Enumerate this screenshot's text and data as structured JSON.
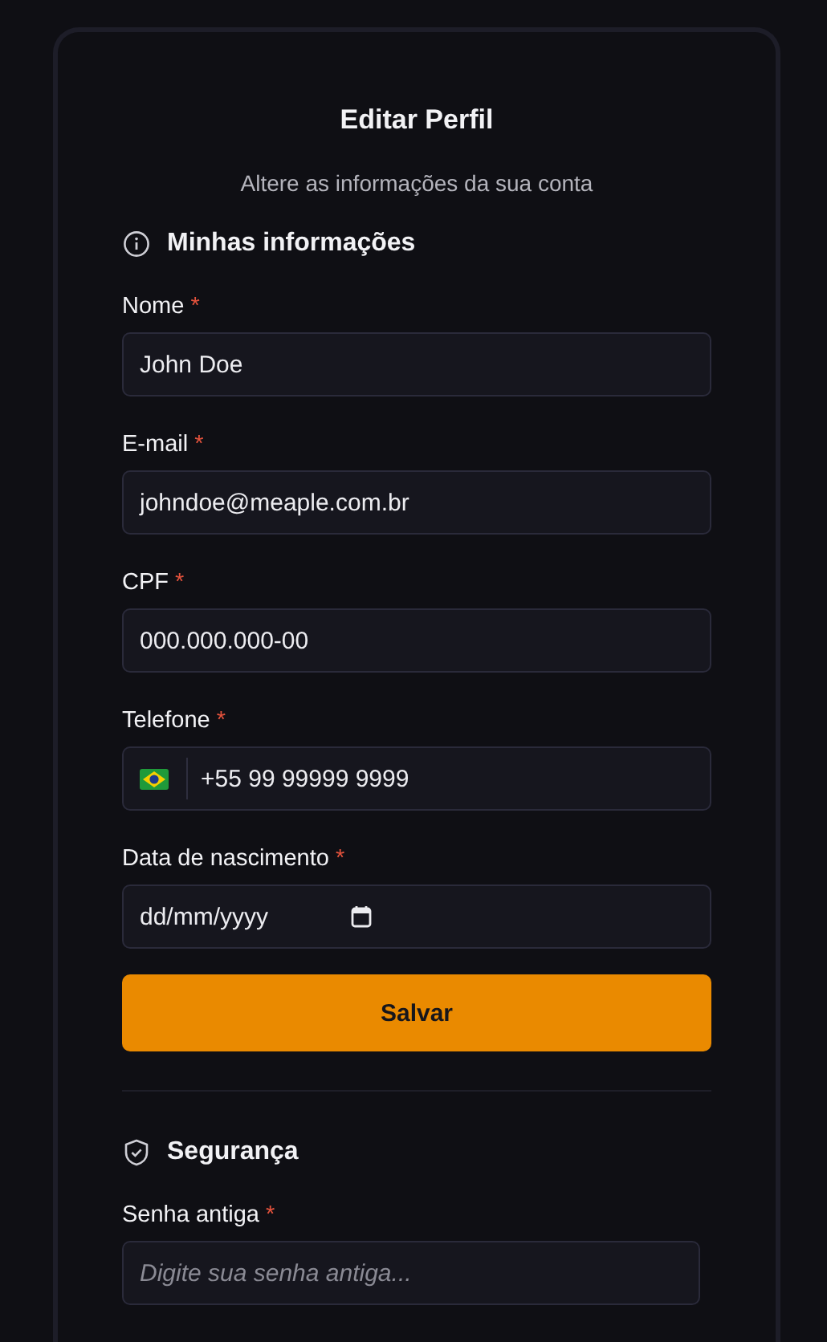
{
  "title": "Editar Perfil",
  "subtitle": "Altere as informações da sua conta",
  "sections": [
    {
      "heading": "Minhas informações",
      "fields": [
        {
          "kind": "text",
          "label": "Nome",
          "required_mark": "*",
          "value": "John Doe"
        },
        {
          "kind": "text",
          "label": "E-mail",
          "required_mark": "*",
          "value": "johndoe@meaple.com.br"
        },
        {
          "kind": "text",
          "label": "CPF",
          "required_mark": "*",
          "value": "000.000.000-00"
        },
        {
          "kind": "phone",
          "label": "Telefone",
          "required_mark": "*",
          "value": "+55 99 99999 9999"
        },
        {
          "kind": "date",
          "label": "Data de nascimento",
          "required_mark": "*",
          "value": "dd/mm/yyyy"
        }
      ],
      "button": "Salvar"
    },
    {
      "heading": "Segurança",
      "fields": [
        {
          "kind": "password",
          "label": "Senha antiga",
          "required_mark": "*",
          "placeholder": "Digite sua senha antiga..."
        }
      ]
    }
  ]
}
